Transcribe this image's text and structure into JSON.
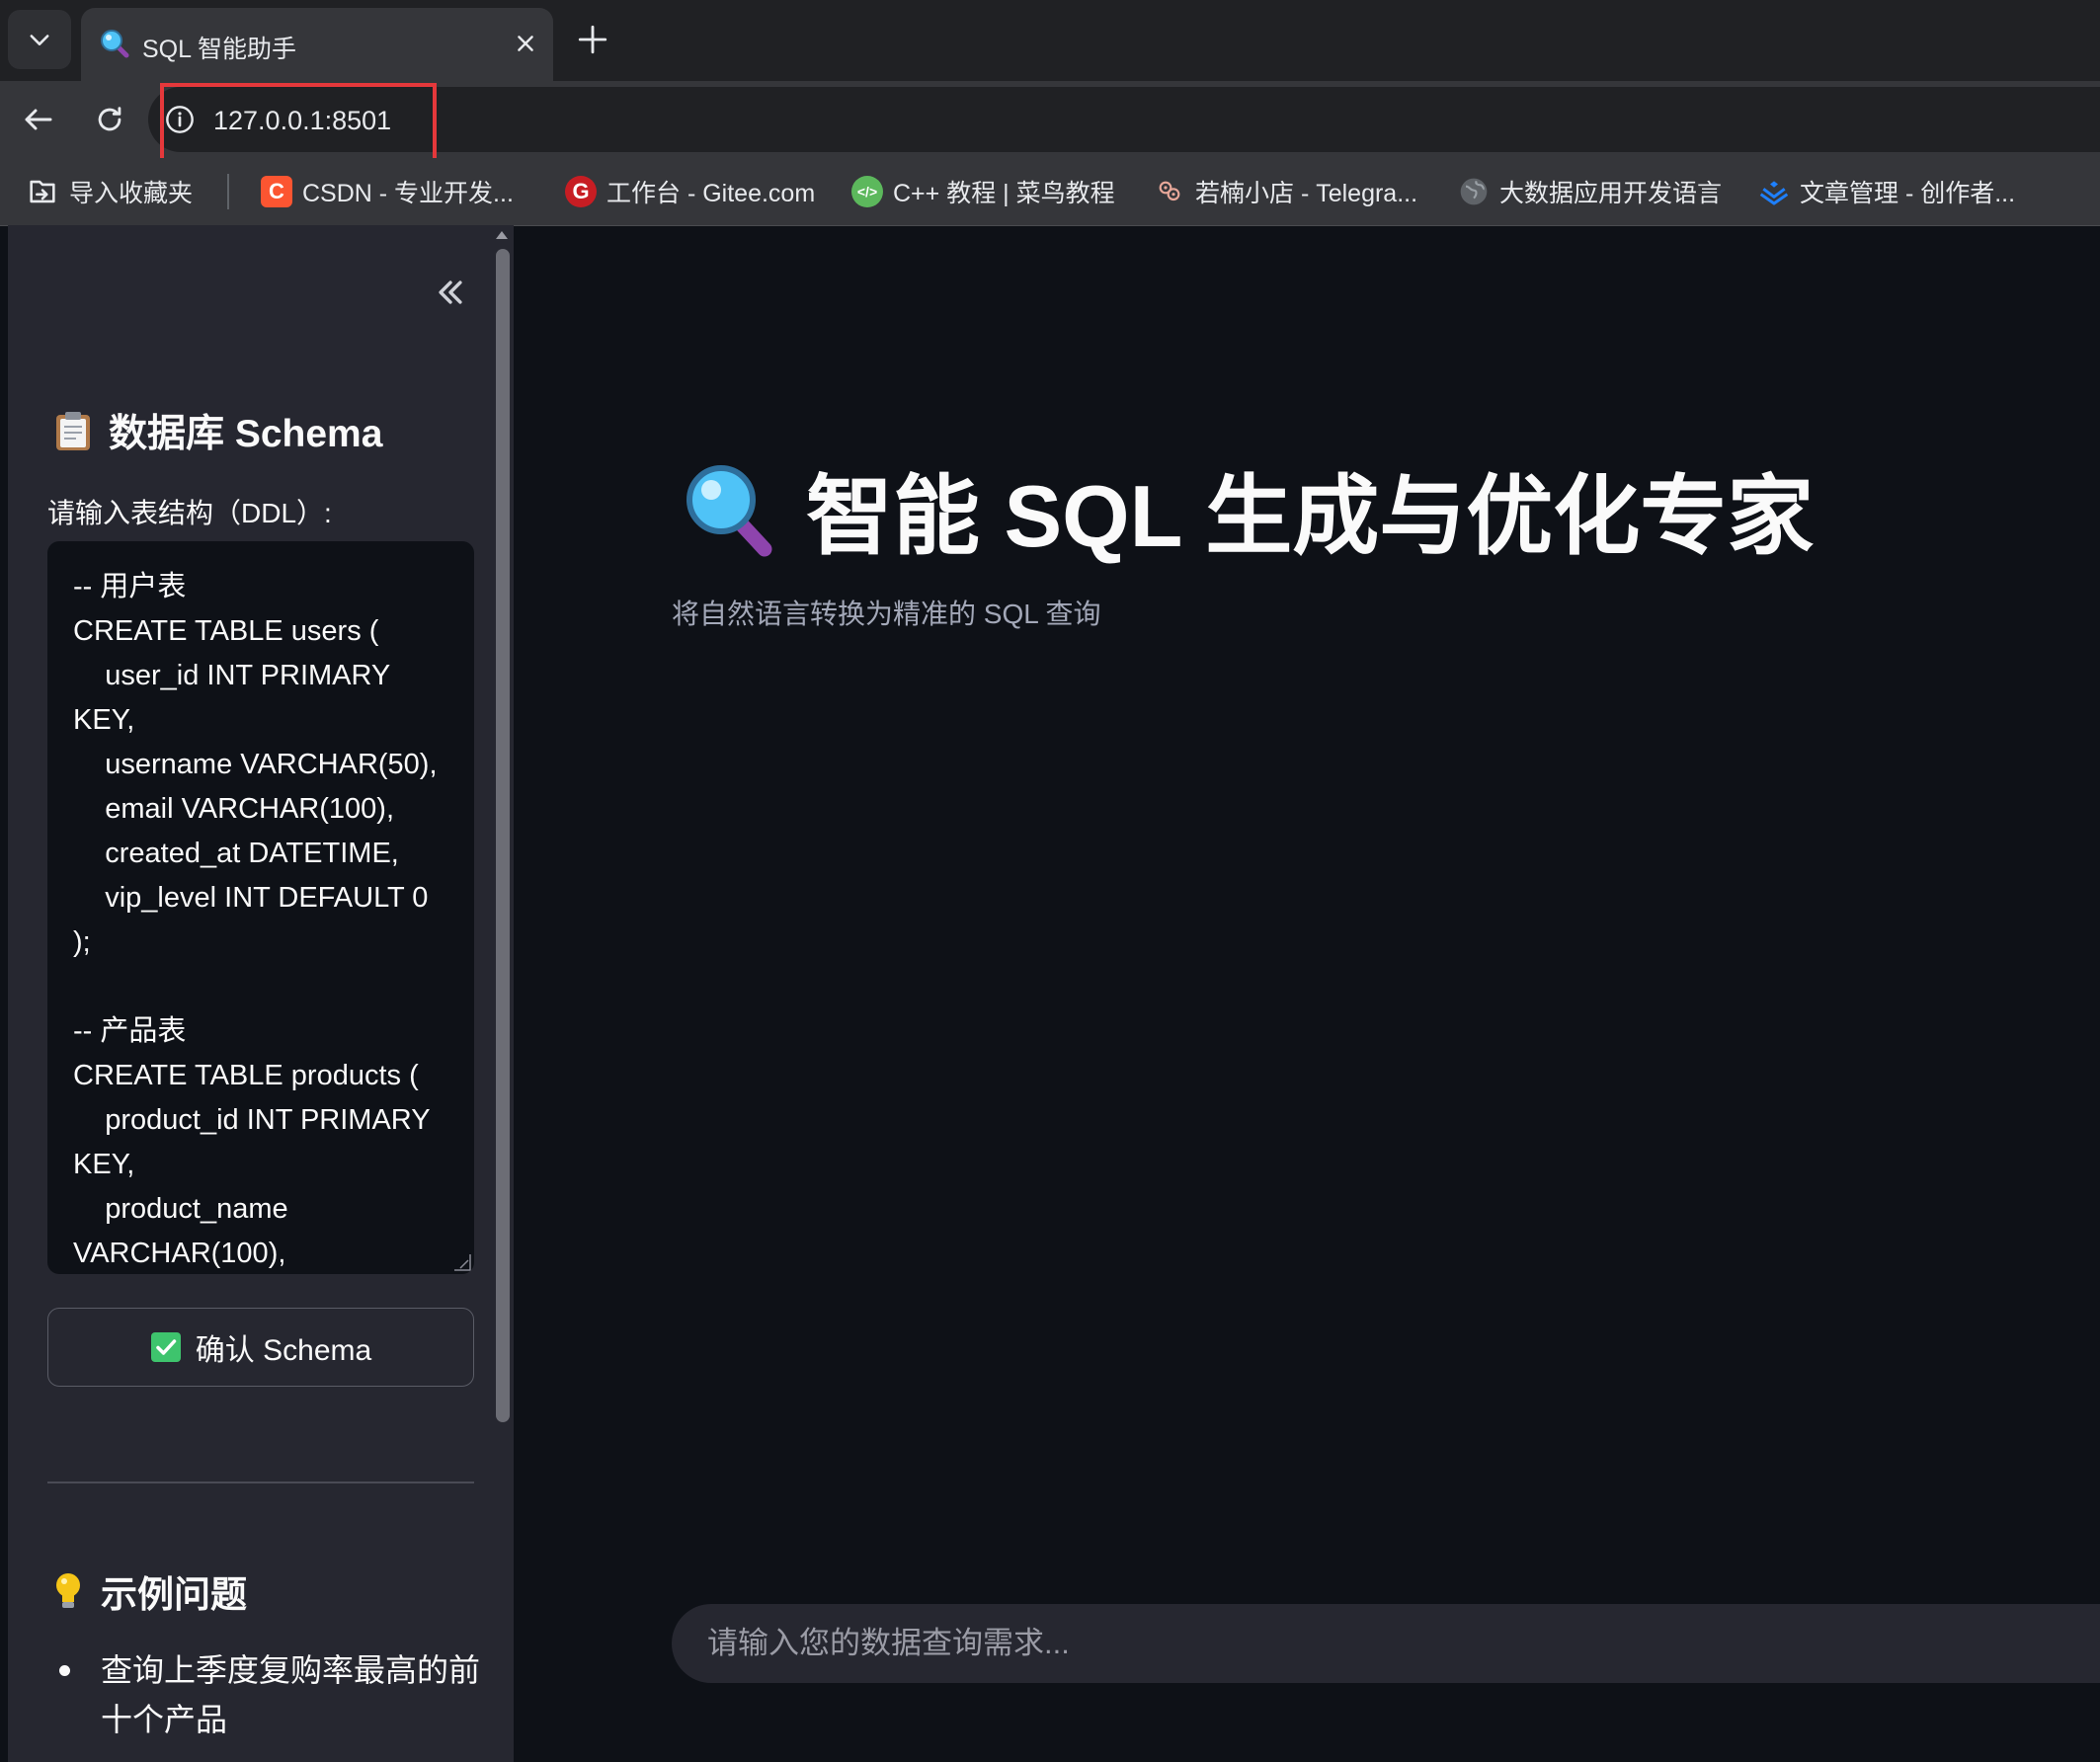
{
  "browser": {
    "tab_title": "SQL 智能助手",
    "url": "127.0.0.1:8501",
    "bookmarks": [
      {
        "label": "导入收藏夹",
        "icon": "import-bookmarks-icon"
      },
      {
        "label": "CSDN - 专业开发...",
        "icon": "csdn-icon",
        "color": "#fc5531"
      },
      {
        "label": "工作台 - Gitee.com",
        "icon": "gitee-icon",
        "color": "#c71d23"
      },
      {
        "label": "C++ 教程 | 菜鸟教程",
        "icon": "runoob-icon",
        "color": "#5cb85c"
      },
      {
        "label": "若楠小店 - Telegra...",
        "icon": "shop-icon"
      },
      {
        "label": "大数据应用开发语言",
        "icon": "globe-icon"
      },
      {
        "label": "文章管理 - 创作者...",
        "icon": "juejin-icon",
        "color": "#1e80ff"
      }
    ]
  },
  "sidebar": {
    "schema_title": "数据库 Schema",
    "ddl_label": "请输入表结构（DDL）:",
    "ddl_value": "-- 用户表\nCREATE TABLE users (\n    user_id INT PRIMARY KEY,\n    username VARCHAR(50),\n    email VARCHAR(100),\n    created_at DATETIME,\n    vip_level INT DEFAULT 0\n);\n\n-- 产品表\nCREATE TABLE products (\n    product_id INT PRIMARY KEY,\n    product_name VARCHAR(100),",
    "confirm_label": "确认 Schema",
    "examples_title": "示例问题",
    "examples": [
      "查询上季度复购率最高的前十个产品"
    ]
  },
  "main": {
    "title": "智能 SQL 生成与优化专家",
    "subtitle": "将自然语言转换为精准的 SQL 查询",
    "input_placeholder": "请输入您的数据查询需求..."
  },
  "colors": {
    "background": "#0e1117",
    "sidebar": "#262730",
    "highlight": "#e5383b",
    "check": "#3ec46d"
  }
}
